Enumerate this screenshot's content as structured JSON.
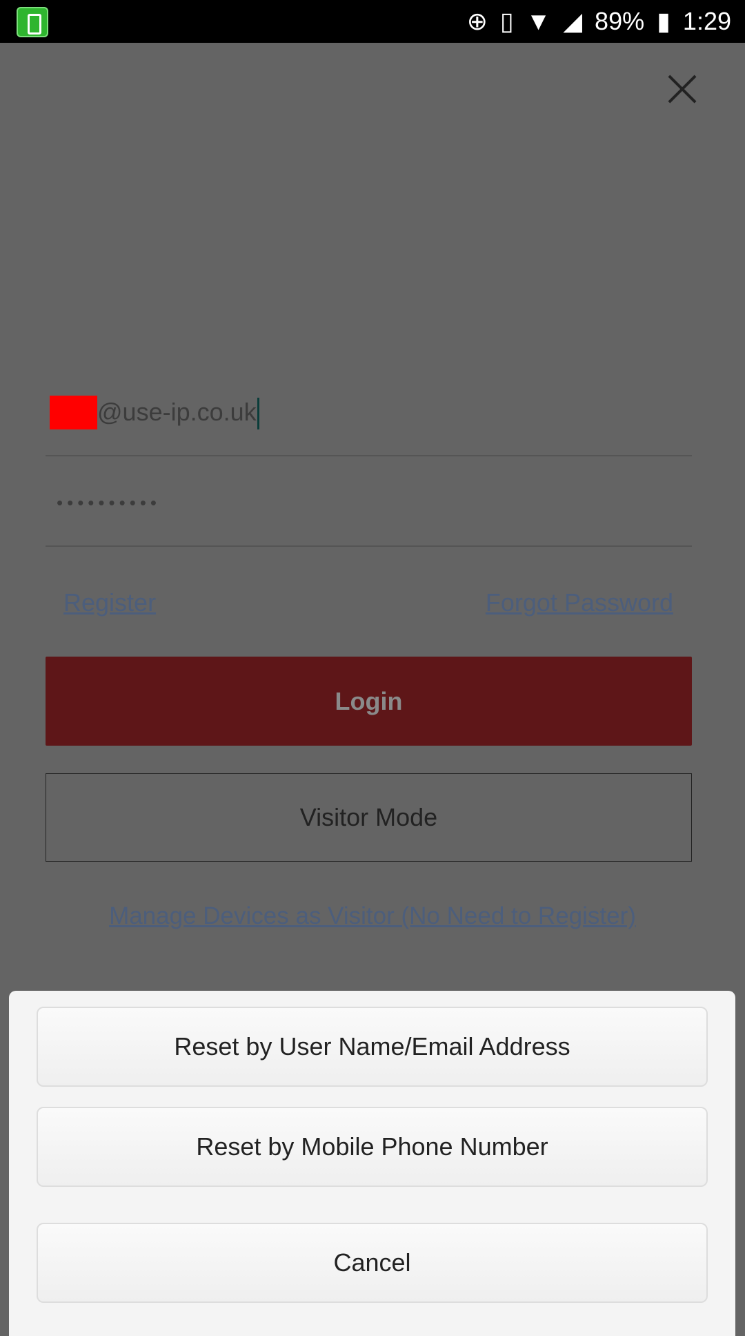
{
  "status_bar": {
    "battery": "89%",
    "time": "1:29",
    "icons": [
      "app-icon",
      "data-saver-icon",
      "vibrate-icon",
      "wifi-icon",
      "signal-icon",
      "battery-icon"
    ]
  },
  "login": {
    "email_value": "@use-ip.co.uk",
    "password_mask": "••••••••••",
    "register_label": "Register",
    "forgot_label": "Forgot Password",
    "login_label": "Login",
    "visitor_label": "Visitor Mode",
    "manage_label": "Manage Devices as Visitor (No Need to Register)"
  },
  "sheet": {
    "options": [
      "Reset by User Name/Email Address",
      "Reset by Mobile Phone Number"
    ],
    "cancel_label": "Cancel"
  },
  "colors": {
    "login_button": "#5e1618",
    "link": "#4c5e7c",
    "overlay": "#646464"
  }
}
